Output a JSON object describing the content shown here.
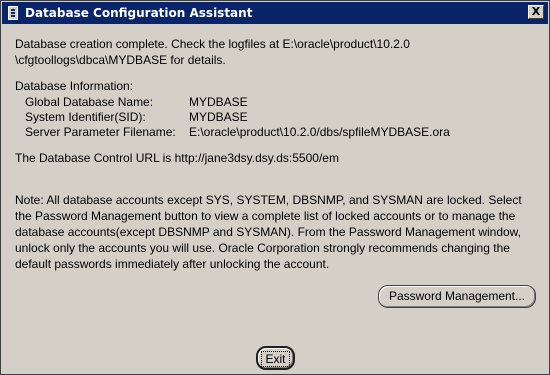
{
  "window": {
    "title": "Database Configuration Assistant",
    "close_label": "X"
  },
  "message": {
    "line1": "Database creation complete. Check the logfiles at E:\\oracle\\product\\10.2.0",
    "line2": "\\cfgtoollogs\\dbca\\MYDBASE for details."
  },
  "db_info": {
    "heading": "Database Information:",
    "rows": [
      {
        "label": "Global Database Name:",
        "value": "MYDBASE"
      },
      {
        "label": "System Identifier(SID):",
        "value": "MYDBASE"
      },
      {
        "label": "Server Parameter Filename:",
        "value": "E:\\oracle\\product\\10.2.0/dbs/spfileMYDBASE.ora"
      }
    ]
  },
  "control_url": "The Database Control URL is http://jane3dsy.dsy.ds:5500/em",
  "note": [
    "Note: All database accounts except SYS, SYSTEM, DBSNMP, and SYSMAN are locked. Select",
    "the Password Management button to view a complete list of locked accounts or to manage the",
    "database accounts(except DBSNMP and SYSMAN). From the Password Management window,",
    "unlock only the accounts you will use. Oracle Corporation strongly recommends changing the",
    "default passwords immediately after unlocking the account."
  ],
  "buttons": {
    "password_management": "Password Management...",
    "exit": "Exit"
  }
}
